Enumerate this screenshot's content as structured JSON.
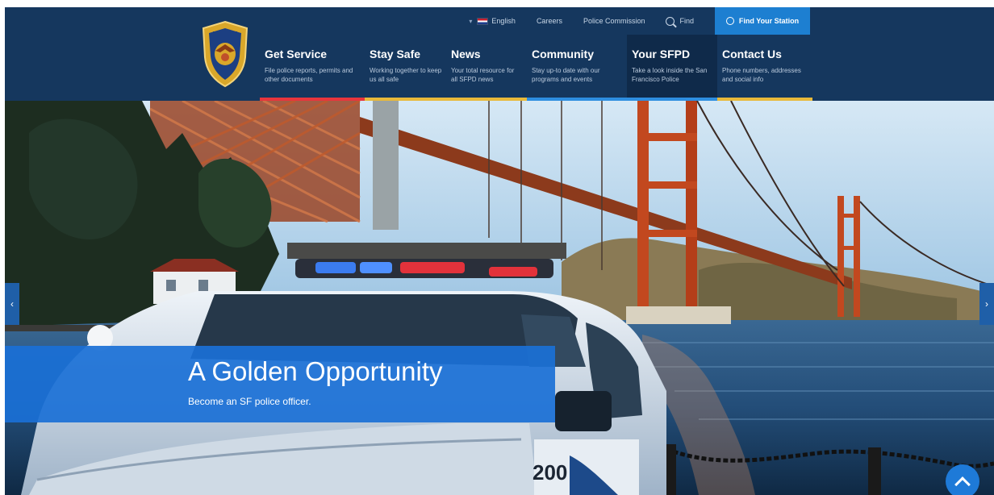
{
  "utility": {
    "language": "English",
    "links": [
      "Careers",
      "Police Commission"
    ],
    "find": "Find",
    "station": "Find Your Station"
  },
  "nav": [
    {
      "title": "Get Service",
      "desc": "File police reports, permits and other documents",
      "accent": "#e8353c"
    },
    {
      "title": "Stay Safe",
      "desc": "Working together to keep us all safe",
      "accent": "#e8b93a"
    },
    {
      "title": "News",
      "desc": "Your total resource for all SFPD news",
      "accent": "#e8b93a"
    },
    {
      "title": "Community",
      "desc": "Stay up-to date with our programs and events",
      "accent": "#2e8ee0"
    },
    {
      "title": "Your SFPD",
      "desc": "Take a look inside the San Francisco Police",
      "accent": "#2e8ee0"
    },
    {
      "title": "Contact Us",
      "desc": "Phone numbers, addresses and social info",
      "accent": "#e8b93a"
    }
  ],
  "hero": {
    "title": "A Golden Opportunity",
    "subtitle": "Become an SF police officer.",
    "car_number": "200"
  },
  "colors": {
    "header": "#15375e",
    "accent_blue": "#1d7fd1",
    "bridge": "#b8421f"
  },
  "icons": {
    "prev": "chevron-left-icon",
    "next": "chevron-right-icon",
    "top": "chevron-up-icon",
    "search": "search-icon",
    "station": "location-pin-icon"
  }
}
